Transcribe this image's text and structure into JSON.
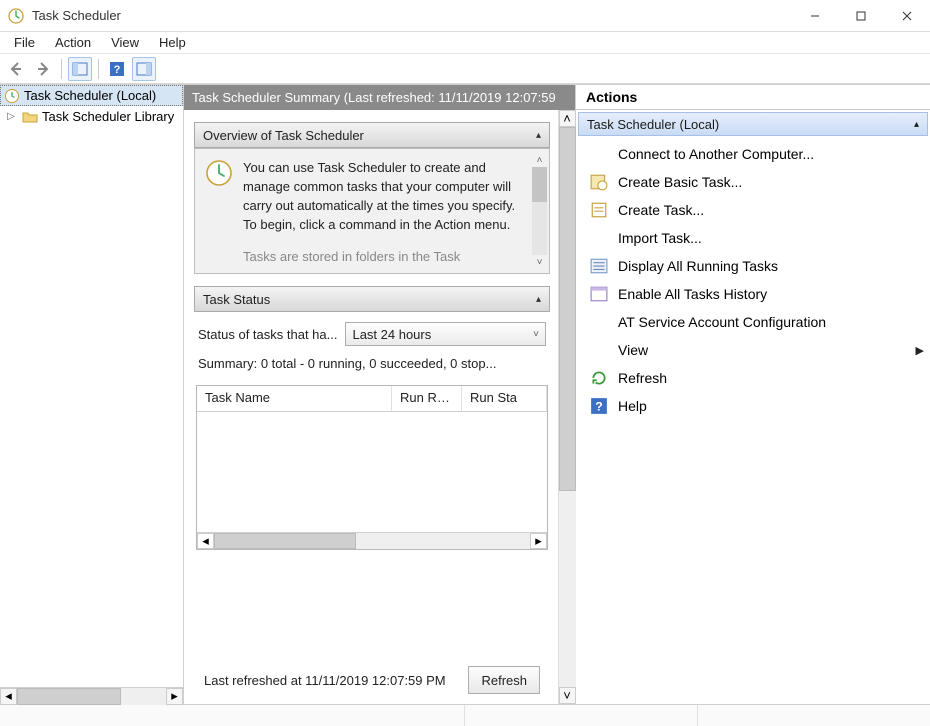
{
  "window": {
    "title": "Task Scheduler"
  },
  "menu": {
    "file": "File",
    "action": "Action",
    "view": "View",
    "help": "Help"
  },
  "tree": {
    "root": "Task Scheduler (Local)",
    "child": "Task Scheduler Library"
  },
  "summary_header": "Task Scheduler Summary (Last refreshed: 11/11/2019 12:07:59",
  "overview": {
    "title": "Overview of Task Scheduler",
    "text": "You can use Task Scheduler to create and manage common tasks that your computer will carry out automatically at the times you specify. To begin, click a command in the Action menu.",
    "truncated_next": "Tasks are stored in folders in the Task"
  },
  "task_status": {
    "title": "Task Status",
    "filter_label": "Status of tasks that ha...",
    "filter_value": "Last 24 hours",
    "summary": "Summary: 0 total - 0 running, 0 succeeded, 0 stop...",
    "columns": {
      "c1": "Task Name",
      "c2": "Run Res...",
      "c3": "Run Sta"
    }
  },
  "bottom": {
    "last_refreshed": "Last refreshed at 11/11/2019 12:07:59 PM",
    "refresh": "Refresh"
  },
  "actions": {
    "header": "Actions",
    "subhead": "Task Scheduler (Local)",
    "items": {
      "connect": "Connect to Another Computer...",
      "create_basic": "Create Basic Task...",
      "create_task": "Create Task...",
      "import_task": "Import Task...",
      "display_running": "Display All Running Tasks",
      "enable_history": "Enable All Tasks History",
      "at_config": "AT Service Account Configuration",
      "view": "View",
      "refresh": "Refresh",
      "help": "Help"
    }
  }
}
